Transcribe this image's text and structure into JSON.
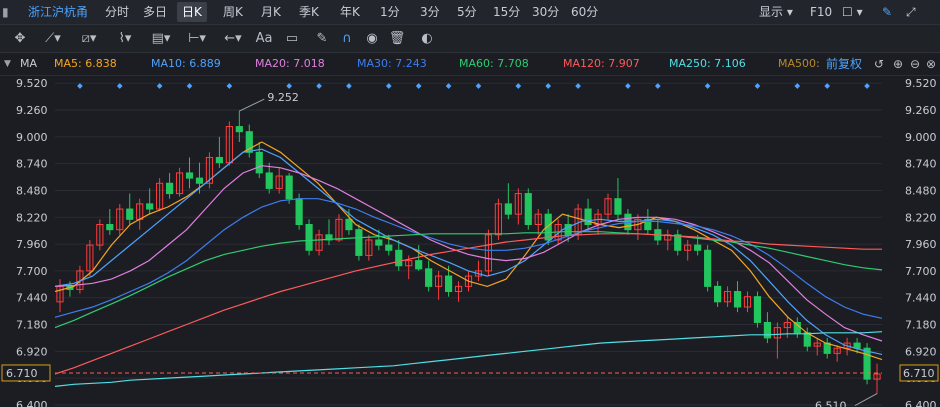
{
  "toolbar": {
    "stock_name": "浙江沪杭甬",
    "timeframes": [
      "分时",
      "多日",
      "日K",
      "周K",
      "月K",
      "季K",
      "年K",
      "1分",
      "3分",
      "5分",
      "15分",
      "30分",
      "60分"
    ],
    "active_timeframe": "日K",
    "display_label": "显示",
    "f10_label": "F10"
  },
  "drawing_tools": [
    "crosshair-icon",
    "line-icon",
    "channel-icon",
    "wave-icon",
    "fibonacci-icon",
    "measure-icon",
    "arrow-icon",
    "text-icon",
    "note-icon",
    "pen-icon",
    "magnet-icon",
    "eye-icon",
    "trash-icon",
    "toggle-icon"
  ],
  "text_tool_label": "Aa",
  "legend": {
    "title": "MA",
    "restore_label": "前复权",
    "items": [
      {
        "label": "MA5: 6.838",
        "color": "#f5a623"
      },
      {
        "label": "MA10: 6.889",
        "color": "#4da3ff"
      },
      {
        "label": "MA20: 7.018",
        "color": "#e27ee0"
      },
      {
        "label": "MA30: 7.243",
        "color": "#3d7ef0"
      },
      {
        "label": "MA60: 7.708",
        "color": "#2ecc71"
      },
      {
        "label": "MA120: 7.907",
        "color": "#ff5a5a"
      },
      {
        "label": "MA250: 7.106",
        "color": "#4fe0e6"
      },
      {
        "label": "MA500:",
        "color": "#b58a2e"
      }
    ]
  },
  "chart_data": {
    "type": "candlestick",
    "y_ticks": [
      "9.520",
      "9.260",
      "9.000",
      "8.740",
      "8.480",
      "8.220",
      "7.960",
      "7.700",
      "7.440",
      "7.180",
      "6.920",
      "6.660",
      "6.400"
    ],
    "ylim": [
      6.38,
      9.6
    ],
    "current_price": "6.710",
    "high_annotation": "9.252",
    "low_annotation": "6.510",
    "colors": {
      "up": "#ff3b3b",
      "down": "#22c55e",
      "grid": "#2a2d33"
    },
    "candles": [
      [
        7.4,
        7.62,
        7.3,
        7.55
      ],
      [
        7.55,
        7.6,
        7.45,
        7.52
      ],
      [
        7.52,
        7.75,
        7.48,
        7.7
      ],
      [
        7.7,
        8.0,
        7.65,
        7.95
      ],
      [
        7.95,
        8.2,
        7.9,
        8.15
      ],
      [
        8.15,
        8.3,
        8.05,
        8.1
      ],
      [
        8.1,
        8.35,
        8.05,
        8.3
      ],
      [
        8.3,
        8.45,
        8.15,
        8.2
      ],
      [
        8.2,
        8.4,
        8.1,
        8.35
      ],
      [
        8.35,
        8.5,
        8.25,
        8.3
      ],
      [
        8.3,
        8.6,
        8.28,
        8.55
      ],
      [
        8.55,
        8.65,
        8.4,
        8.45
      ],
      [
        8.45,
        8.7,
        8.42,
        8.65
      ],
      [
        8.65,
        8.8,
        8.5,
        8.6
      ],
      [
        8.6,
        8.75,
        8.45,
        8.55
      ],
      [
        8.55,
        8.85,
        8.5,
        8.8
      ],
      [
        8.8,
        9.0,
        8.7,
        8.75
      ],
      [
        8.75,
        9.15,
        8.72,
        9.1
      ],
      [
        9.1,
        9.25,
        8.95,
        9.05
      ],
      [
        9.05,
        9.12,
        8.8,
        8.85
      ],
      [
        8.85,
        8.95,
        8.6,
        8.65
      ],
      [
        8.65,
        8.75,
        8.45,
        8.5
      ],
      [
        8.5,
        8.7,
        8.45,
        8.62
      ],
      [
        8.62,
        8.65,
        8.35,
        8.4
      ],
      [
        8.4,
        8.45,
        8.1,
        8.15
      ],
      [
        8.15,
        8.2,
        7.85,
        7.9
      ],
      [
        7.9,
        8.1,
        7.85,
        8.05
      ],
      [
        8.05,
        8.2,
        7.95,
        8.0
      ],
      [
        8.0,
        8.25,
        7.98,
        8.2
      ],
      [
        8.2,
        8.3,
        8.05,
        8.1
      ],
      [
        8.1,
        8.15,
        7.8,
        7.85
      ],
      [
        7.85,
        8.05,
        7.8,
        8.0
      ],
      [
        8.0,
        8.1,
        7.9,
        7.95
      ],
      [
        7.95,
        8.05,
        7.85,
        7.9
      ],
      [
        7.9,
        8.0,
        7.7,
        7.75
      ],
      [
        7.75,
        7.85,
        7.62,
        7.8
      ],
      [
        7.8,
        7.95,
        7.7,
        7.72
      ],
      [
        7.72,
        7.8,
        7.5,
        7.55
      ],
      [
        7.55,
        7.7,
        7.42,
        7.65
      ],
      [
        7.65,
        7.75,
        7.45,
        7.5
      ],
      [
        7.5,
        7.6,
        7.4,
        7.55
      ],
      [
        7.55,
        7.7,
        7.5,
        7.65
      ],
      [
        7.65,
        7.8,
        7.6,
        7.7
      ],
      [
        7.7,
        8.1,
        7.65,
        8.05
      ],
      [
        8.05,
        8.4,
        8.0,
        8.35
      ],
      [
        8.35,
        8.55,
        8.2,
        8.25
      ],
      [
        8.25,
        8.5,
        8.15,
        8.45
      ],
      [
        8.45,
        8.5,
        8.1,
        8.15
      ],
      [
        8.15,
        8.3,
        8.05,
        8.25
      ],
      [
        8.25,
        8.3,
        7.95,
        8.0
      ],
      [
        8.0,
        8.2,
        7.95,
        8.15
      ],
      [
        8.15,
        8.25,
        7.98,
        8.05
      ],
      [
        8.05,
        8.35,
        8.0,
        8.3
      ],
      [
        8.3,
        8.4,
        8.1,
        8.15
      ],
      [
        8.15,
        8.3,
        8.05,
        8.25
      ],
      [
        8.25,
        8.45,
        8.2,
        8.4
      ],
      [
        8.4,
        8.6,
        8.2,
        8.25
      ],
      [
        8.25,
        8.3,
        8.05,
        8.1
      ],
      [
        8.1,
        8.25,
        8.0,
        8.2
      ],
      [
        8.2,
        8.3,
        8.05,
        8.1
      ],
      [
        8.1,
        8.2,
        7.95,
        8.0
      ],
      [
        8.0,
        8.1,
        7.9,
        8.05
      ],
      [
        8.05,
        8.1,
        7.85,
        7.9
      ],
      [
        7.9,
        8.0,
        7.8,
        7.95
      ],
      [
        7.95,
        8.05,
        7.85,
        7.9
      ],
      [
        7.9,
        7.95,
        7.5,
        7.55
      ],
      [
        7.55,
        7.6,
        7.35,
        7.4
      ],
      [
        7.4,
        7.55,
        7.35,
        7.5
      ],
      [
        7.5,
        7.6,
        7.3,
        7.35
      ],
      [
        7.35,
        7.5,
        7.3,
        7.45
      ],
      [
        7.45,
        7.5,
        7.15,
        7.2
      ],
      [
        7.2,
        7.3,
        7.0,
        7.05
      ],
      [
        7.05,
        7.2,
        6.85,
        7.15
      ],
      [
        7.15,
        7.25,
        7.05,
        7.2
      ],
      [
        7.2,
        7.25,
        7.05,
        7.1
      ],
      [
        7.1,
        7.15,
        6.92,
        6.97
      ],
      [
        6.97,
        7.05,
        6.88,
        7.0
      ],
      [
        7.0,
        7.05,
        6.85,
        6.9
      ],
      [
        6.9,
        6.98,
        6.82,
        6.95
      ],
      [
        6.95,
        7.05,
        6.88,
        7.0
      ],
      [
        7.0,
        7.05,
        6.9,
        6.95
      ],
      [
        6.95,
        7.0,
        6.6,
        6.65
      ],
      [
        6.65,
        6.8,
        6.51,
        6.7
      ]
    ],
    "ma": [
      {
        "name": "MA5",
        "color": "#f5a623",
        "points": [
          7.5,
          7.55,
          7.7,
          7.95,
          8.15,
          8.25,
          8.32,
          8.42,
          8.55,
          8.7,
          8.85,
          8.95,
          8.85,
          8.7,
          8.55,
          8.35,
          8.15,
          8.05,
          8.0,
          7.92,
          7.8,
          7.7,
          7.6,
          7.55,
          7.62,
          7.85,
          8.1,
          8.25,
          8.2,
          8.15,
          8.12,
          8.15,
          8.22,
          8.18,
          8.1,
          8.0,
          7.9,
          7.7,
          7.45,
          7.25,
          7.1,
          7.0,
          6.95,
          6.9,
          6.84
        ]
      },
      {
        "name": "MA10",
        "color": "#4da3ff",
        "points": [
          7.55,
          7.58,
          7.65,
          7.8,
          7.95,
          8.1,
          8.25,
          8.4,
          8.55,
          8.7,
          8.85,
          8.88,
          8.8,
          8.65,
          8.5,
          8.35,
          8.2,
          8.1,
          8.0,
          7.92,
          7.85,
          7.78,
          7.7,
          7.65,
          7.7,
          7.8,
          7.95,
          8.1,
          8.18,
          8.2,
          8.18,
          8.18,
          8.2,
          8.18,
          8.12,
          8.05,
          7.95,
          7.8,
          7.6,
          7.4,
          7.22,
          7.08,
          6.98,
          6.93,
          6.89
        ]
      },
      {
        "name": "MA20",
        "color": "#e27ee0",
        "points": [
          7.55,
          7.56,
          7.58,
          7.62,
          7.7,
          7.8,
          7.95,
          8.1,
          8.3,
          8.5,
          8.65,
          8.72,
          8.7,
          8.65,
          8.58,
          8.5,
          8.4,
          8.3,
          8.2,
          8.1,
          8.0,
          7.92,
          7.86,
          7.82,
          7.8,
          7.82,
          7.88,
          7.98,
          8.08,
          8.15,
          8.2,
          8.22,
          8.22,
          8.2,
          8.15,
          8.08,
          8.0,
          7.9,
          7.78,
          7.6,
          7.42,
          7.28,
          7.15,
          7.08,
          7.02
        ]
      },
      {
        "name": "MA30",
        "color": "#3d7ef0",
        "points": [
          7.25,
          7.3,
          7.35,
          7.42,
          7.5,
          7.58,
          7.68,
          7.8,
          7.95,
          8.1,
          8.22,
          8.32,
          8.38,
          8.4,
          8.4,
          8.36,
          8.3,
          8.22,
          8.15,
          8.08,
          8.02,
          7.96,
          7.92,
          7.9,
          7.9,
          7.92,
          7.96,
          8.02,
          8.08,
          8.12,
          8.16,
          8.18,
          8.18,
          8.16,
          8.14,
          8.1,
          8.04,
          7.96,
          7.85,
          7.72,
          7.58,
          7.45,
          7.35,
          7.28,
          7.24
        ]
      },
      {
        "name": "MA60",
        "color": "#2ecc71",
        "points": [
          7.15,
          7.22,
          7.3,
          7.38,
          7.46,
          7.55,
          7.64,
          7.72,
          7.8,
          7.86,
          7.9,
          7.94,
          7.97,
          7.99,
          8.0,
          8.01,
          8.02,
          8.03,
          8.04,
          8.05,
          8.06,
          8.06,
          8.06,
          8.06,
          8.06,
          8.07,
          8.07,
          8.08,
          8.08,
          8.08,
          8.07,
          8.06,
          8.05,
          8.04,
          8.02,
          8.0,
          7.98,
          7.95,
          7.92,
          7.88,
          7.84,
          7.8,
          7.76,
          7.73,
          7.71
        ]
      },
      {
        "name": "MA120",
        "color": "#ff5a5a",
        "points": [
          6.7,
          6.76,
          6.83,
          6.9,
          6.97,
          7.04,
          7.11,
          7.18,
          7.25,
          7.32,
          7.38,
          7.44,
          7.5,
          7.55,
          7.6,
          7.65,
          7.7,
          7.74,
          7.78,
          7.82,
          7.86,
          7.89,
          7.92,
          7.95,
          7.98,
          8.0,
          8.02,
          8.04,
          8.05,
          8.06,
          8.06,
          8.06,
          8.05,
          8.04,
          8.03,
          8.01,
          7.99,
          7.98,
          7.96,
          7.95,
          7.94,
          7.93,
          7.92,
          7.91,
          7.91
        ]
      },
      {
        "name": "MA250",
        "color": "#4fe0e6",
        "points": [
          6.58,
          6.6,
          6.61,
          6.62,
          6.64,
          6.65,
          6.66,
          6.67,
          6.68,
          6.69,
          6.7,
          6.71,
          6.72,
          6.73,
          6.74,
          6.75,
          6.76,
          6.77,
          6.78,
          6.8,
          6.82,
          6.84,
          6.86,
          6.88,
          6.9,
          6.92,
          6.94,
          6.96,
          6.98,
          7.0,
          7.01,
          7.02,
          7.03,
          7.04,
          7.05,
          7.06,
          7.07,
          7.08,
          7.08,
          7.09,
          7.09,
          7.1,
          7.1,
          7.1,
          7.11
        ]
      }
    ]
  }
}
